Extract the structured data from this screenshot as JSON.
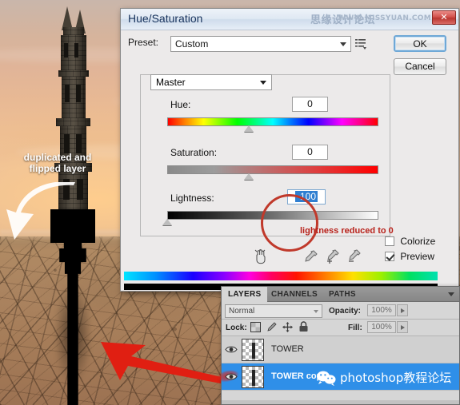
{
  "canvas": {
    "annotation_left": "duplicated and\nflipped layer",
    "annotation_left_line1": "duplicated and",
    "annotation_left_line2": "flipped layer",
    "white_arrow_icon": "curved-arrow-icon",
    "red_arrow_icon": "arrow-left-icon"
  },
  "dialog": {
    "title": "Hue/Saturation",
    "watermark_cn": "思缘设计论坛",
    "watermark_url": "WWW.MISSYUAN.COM",
    "close_label": "✕",
    "preset_label": "Preset:",
    "preset_value": "Custom",
    "preset_menu_icon": "preset-menu-icon",
    "ok_label": "OK",
    "cancel_label": "Cancel",
    "channel_value": "Master",
    "sliders": [
      {
        "label": "Hue:",
        "value": "0",
        "thumb_pct": 50,
        "track": "hue"
      },
      {
        "label": "Saturation:",
        "value": "0",
        "thumb_pct": 50,
        "track": "sat"
      },
      {
        "label": "Lightness:",
        "value": "-100",
        "thumb_pct": 0,
        "track": "light",
        "selected": true
      }
    ],
    "red_note": "lightness reduced to 0",
    "colorize_label": "Colorize",
    "colorize_checked": false,
    "preview_label": "Preview",
    "preview_checked": true,
    "eyedroppers": [
      "eyedropper-icon",
      "eyedropper-add-icon",
      "eyedropper-subtract-icon"
    ],
    "hand_cursor_icon": "hand-cursor-icon"
  },
  "layers_panel": {
    "tabs": [
      {
        "label": "LAYERS",
        "active": true
      },
      {
        "label": "CHANNELS",
        "active": false
      },
      {
        "label": "PATHS",
        "active": false
      }
    ],
    "panel_menu_icon": "chevron-down-icon",
    "blend_mode": "Normal",
    "opacity_label": "Opacity:",
    "opacity_value": "100%",
    "fill_label": "Fill:",
    "fill_value": "100%",
    "lock_label": "Lock:",
    "lock_icons": [
      "lock-transparency-icon",
      "lock-image-icon",
      "lock-position-icon",
      "lock-all-icon"
    ],
    "rows": [
      {
        "name": "TOWER",
        "visible": true,
        "selected": false,
        "eye_icon": "eye-icon"
      },
      {
        "name": "TOWER copy",
        "visible": true,
        "selected": true,
        "eye_icon": "eye-icon"
      }
    ],
    "watermark_text": "photoshop教程论坛",
    "watermark_icon": "wechat-icon"
  },
  "colors": {
    "accent": "#2f8fe8",
    "annotation_red": "#b8221b",
    "close_red": "#b93731",
    "title_blue": "#16325c"
  }
}
